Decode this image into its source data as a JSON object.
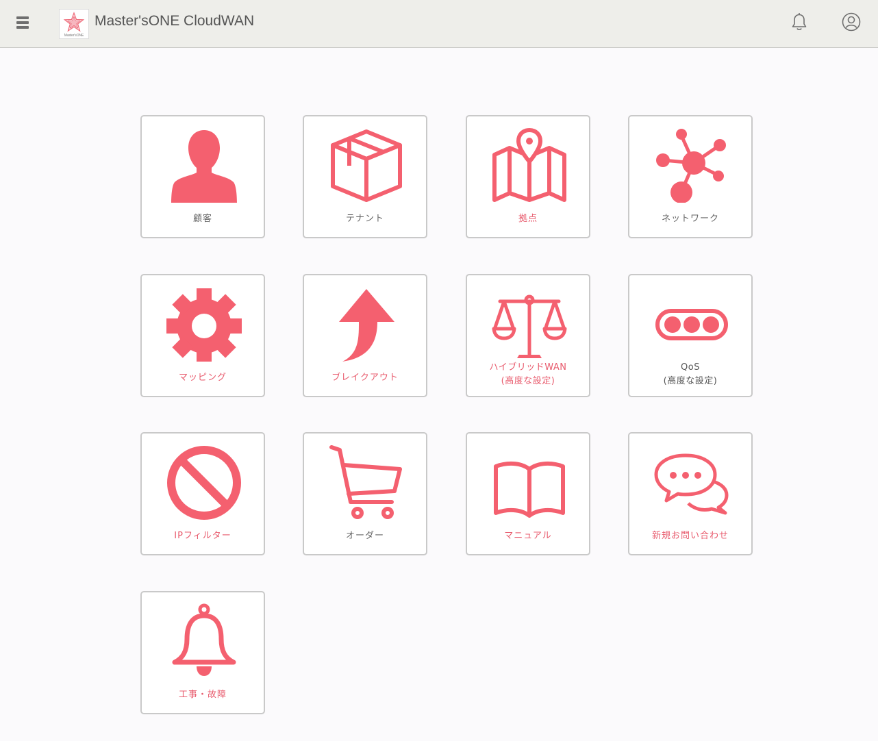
{
  "header": {
    "title": "Master'sONE CloudWAN",
    "logo_text": "Master'sONE",
    "menu_icon": "hamburger-menu-icon",
    "notification_icon": "bell-icon",
    "account_icon": "user-account-icon"
  },
  "tiles": [
    {
      "label": "顧客",
      "icon": "person-icon"
    },
    {
      "label": "テナント",
      "icon": "box-icon"
    },
    {
      "label": "拠点",
      "icon": "map-pin-icon"
    },
    {
      "label": "ネットワーク",
      "icon": "network-hub-icon"
    },
    {
      "label": "マッピング",
      "icon": "gear-icon"
    },
    {
      "label": "ブレイクアウト",
      "icon": "arrow-up-icon"
    },
    {
      "label_line1": "ハイブリッドWAN",
      "label_line2": "(高度な設定)",
      "icon": "scales-icon"
    },
    {
      "label_line1": "QoS",
      "label_line2": "(高度な設定)",
      "icon": "qos-dots-icon"
    },
    {
      "label": "IPフィルター",
      "icon": "prohibited-icon"
    },
    {
      "label": "オーダー",
      "icon": "shopping-cart-icon"
    },
    {
      "label": "マニュアル",
      "icon": "open-book-icon"
    },
    {
      "label": "新規お問い合わせ",
      "icon": "chat-bubbles-icon"
    },
    {
      "label": "工事・故障",
      "icon": "bell-icon"
    }
  ],
  "colors": {
    "accent": "#f4606f",
    "label_pink": "#e85b6d",
    "label_gray": "#666666",
    "header_bg": "#eeeeea",
    "page_bg": "#fbfafc",
    "tile_border": "#c9c9c9"
  }
}
